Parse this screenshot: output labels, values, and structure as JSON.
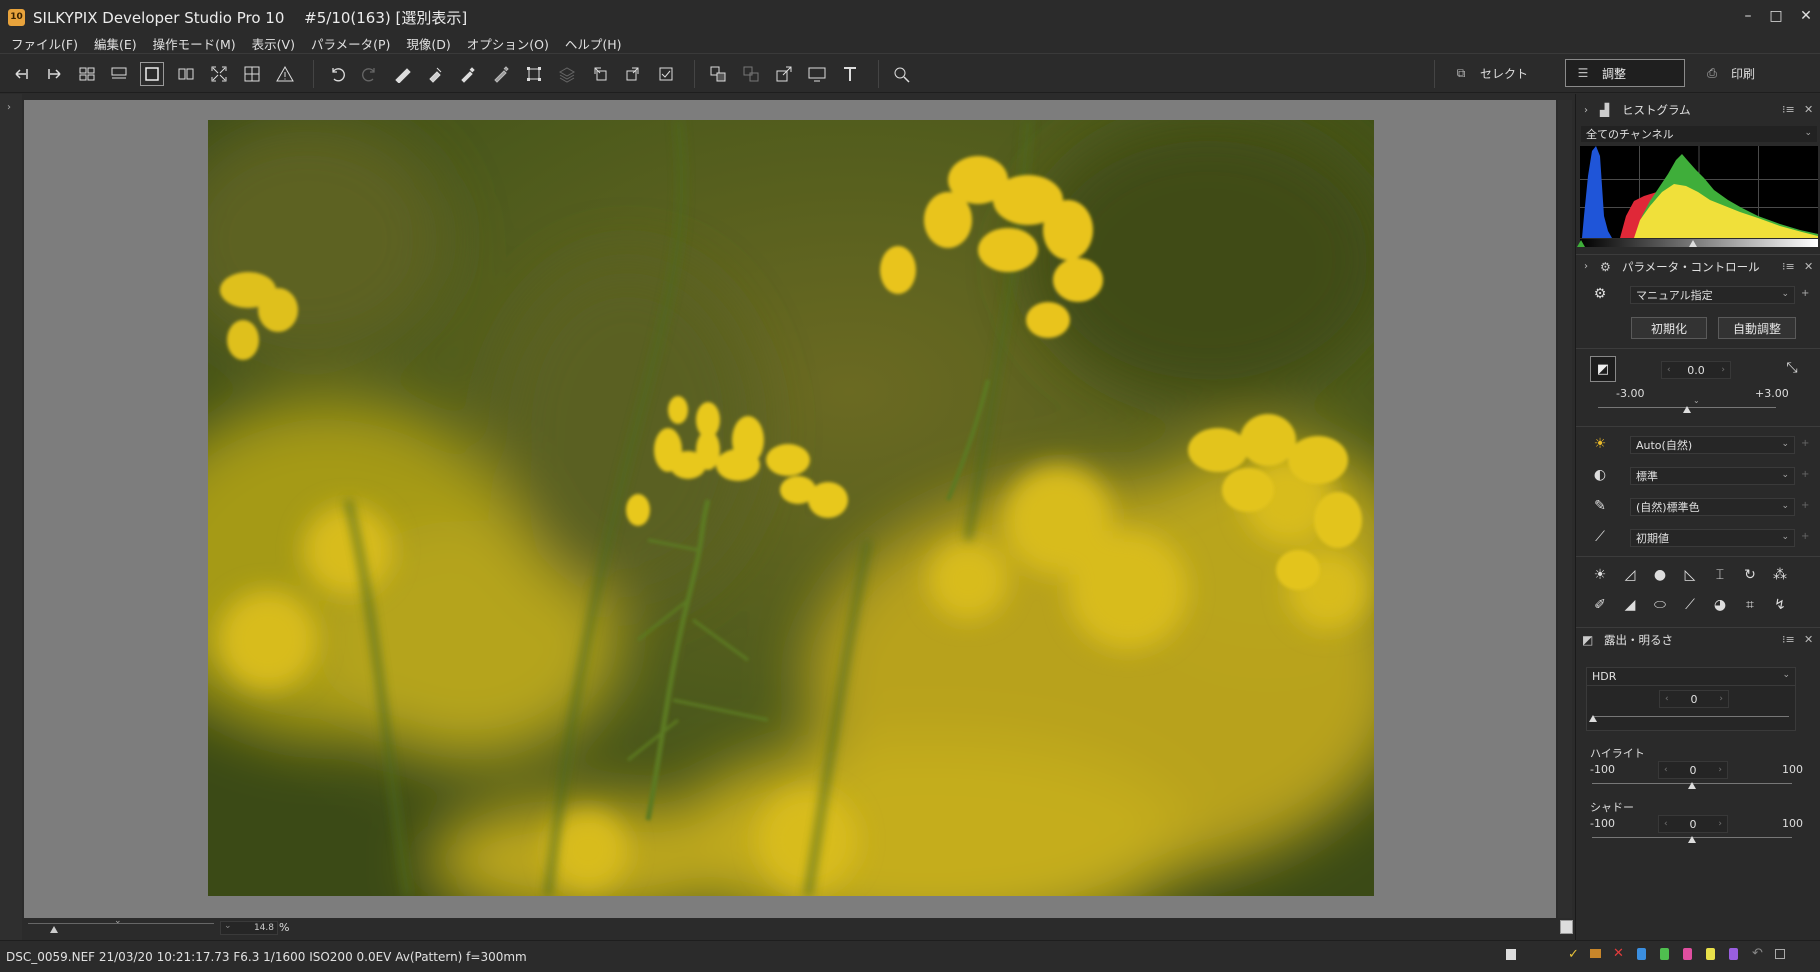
{
  "window": {
    "app_icon": "10",
    "title": "SILKYPIX Developer Studio Pro 10 　#5/10(163) [選別表示]",
    "controls": [
      "–",
      "□",
      "✕"
    ]
  },
  "menu": [
    "ファイル(F)",
    "編集(E)",
    "操作モード(M)",
    "表示(V)",
    "パラメータ(P)",
    "現像(D)",
    "オプション(O)",
    "ヘルプ(H)"
  ],
  "modes": {
    "select": "セレクト",
    "adjust": "調整",
    "print": "印刷"
  },
  "histogram": {
    "title": "ヒストグラム",
    "channel": "全てのチャンネル"
  },
  "param_control": {
    "title": "パラメータ・コントロール",
    "preset": "マニュアル指定",
    "reset_button": "初期化",
    "auto_button": "自動調整",
    "exposure": {
      "value": "0.0",
      "min": "-3.00",
      "max": "+3.00",
      "level": 0.5
    },
    "white_balance": "Auto(自然)",
    "tone": "標準",
    "color": "(自然)標準色",
    "sharpness": "初期値"
  },
  "exposure_panel": {
    "title": "露出・明るさ",
    "hdr": {
      "label": "HDR",
      "value": "0",
      "level": 0.0
    },
    "highlight": {
      "label": "ハイライト",
      "value": "0",
      "min": "-100",
      "max": "100",
      "level": 0.5
    },
    "shadow": {
      "label": "シャドー",
      "value": "0",
      "min": "-100",
      "max": "100",
      "level": 0.5
    }
  },
  "zoom": {
    "value": "14.8",
    "unit": "%"
  },
  "status": {
    "text": "DSC_0059.NEF 21/03/20 10:21:17.73 F6.3 1/1600 ISO200  0.0EV Av(Pattern) f=300mm"
  },
  "colors": {
    "accent": "#e8a33c",
    "panel_bg": "#2a2a2a",
    "viewer_bg": "#7d7d7d"
  }
}
